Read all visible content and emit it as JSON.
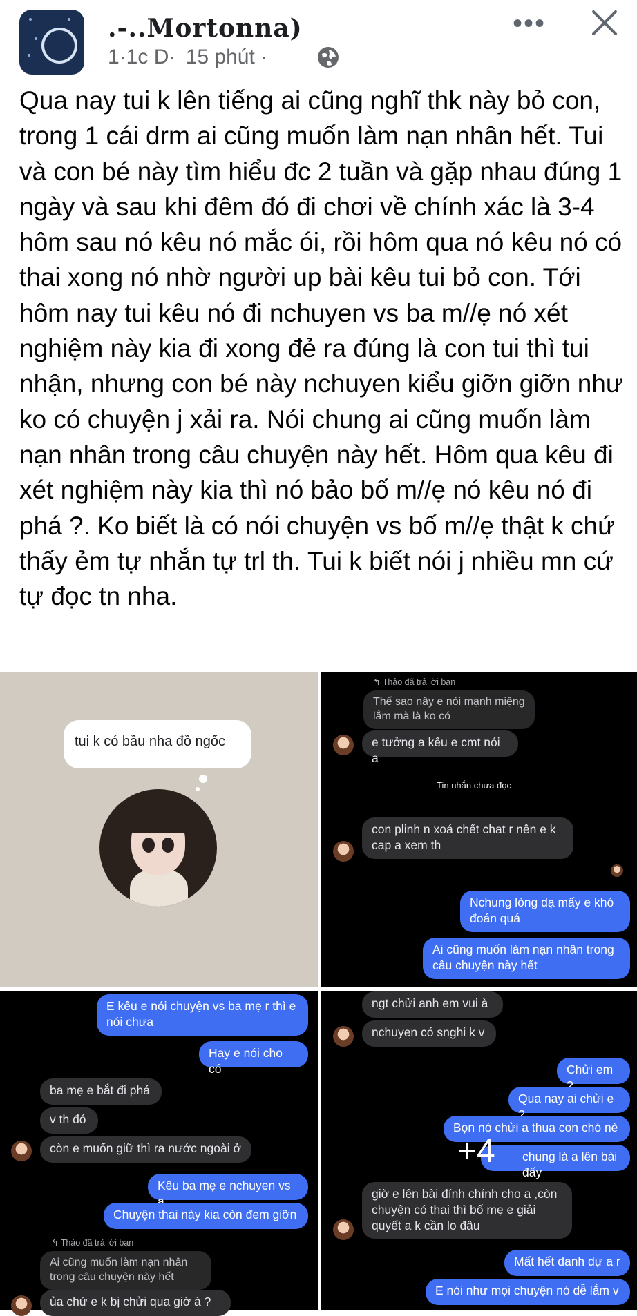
{
  "header": {
    "author_name": ".-..Mortonna)",
    "time_prefix": "1·1c   D·",
    "time_ago": "15 phút ·",
    "globe_icon": "globe-icon",
    "more_icon": "more-horizontal-icon",
    "more_label": "•••",
    "close_icon": "close-icon"
  },
  "post": {
    "text": "Qua nay tui k lên tiếng ai cũng nghĩ thk này bỏ con, trong 1 cái drm ai cũng muốn làm nạn nhân hết. Tui và con bé này tìm hiểu đc 2 tuần và gặp nhau đúng 1 ngày và sau khi đêm đó đi chơi về chính xác là 3-4 hôm sau nó kêu nó mắc ói, rồi hôm qua nó kêu nó có thai xong nó nhờ người up bài kêu tui bỏ con. Tới hôm nay tui kêu nó đi nchuyen vs ba m//ẹ nó xét nghiệm này kia đi xong đẻ ra đúng là con tui thì tui nhận, nhưng con bé này nchuyen kiểu giỡn giỡn như ko có chuyện j xải ra. Nói chung ai cũng muốn làm nạn nhân trong câu chuyện này hết. Hôm qua kêu đi xét nghiệm này kia thì nó bảo bố m//ẹ nó kêu nó đi phá ?. Ko biết là có nói chuyện vs bố m//ẹ thật k chứ thấy ẻm tự nhắn tự trl th. Tui k biết nói j nhiều mn cứ tự đọc tn nha."
  },
  "photo1": {
    "bubble": "tui k có bầu nha đồ ngốc"
  },
  "photo2": {
    "reply_note": "↰ Thảo đã trả lời bạn",
    "quoted": "Thế sao nây e nói mạnh miệng\nlắm mà là ko có",
    "msg1": "e tưởng a kêu e cmt nói a",
    "unread": "Tin nhắn chưa đọc",
    "msg2": "con plinh n xoá chết chat r nên e k\ncap a xem th",
    "msg3": "Nchung lòng dạ mấy e khó\nđoán quá",
    "msg4": "Ai cũng muốn làm nạn nhân trong\ncâu chuyện này hết"
  },
  "photo3": {
    "msg1": "E kêu e nói chuyện vs ba mẹ r thì e\nnói chưa",
    "msg2": "Hay e nói cho có",
    "msg3": "ba mẹ e bắt đi phá",
    "msg4": "v th đó",
    "msg5": "còn e muốn giữ thì ra nước ngoài ở",
    "msg6": "Kêu ba mẹ e nchuyen vs a",
    "msg7": "Chuyện thai này kia còn đem giỡn",
    "reply_note": "↰ Thảo đã trả lời bạn",
    "quoted": "Ai cũng muốn làm nạn nhân\ntrong câu chuyện này hết",
    "msg8": "ủa chứ e k bị chửi qua giờ à ?"
  },
  "photo4": {
    "msg1": "ngt chửi anh em vui à",
    "msg2": "nchuyen có snghi k v",
    "msg3": "Chửi em ?",
    "msg4": "Qua nay ai chửi e ?",
    "msg5": "Bọn nó chửi a thua con chó nè",
    "msg6": "chung là a lên bài đấy",
    "msg7": "giờ e lên bài đính chính cho a ,còn\nchuyện có thai thì bố mẹ e giải\nquyết a k cần lo đâu",
    "msg8": "Mất hết danh dự a r",
    "msg9": "E nói như mọi chuyện nó dễ lắm v",
    "more_count": "+4"
  }
}
